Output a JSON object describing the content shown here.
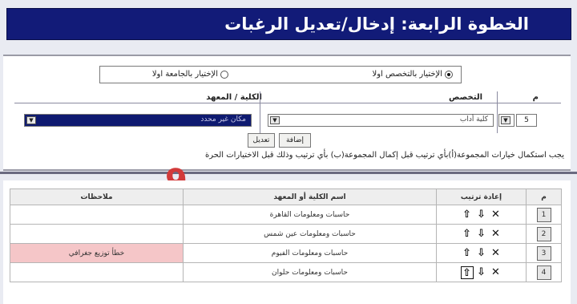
{
  "banner": {
    "title": "الخطوة الرابعة: إدخال/تعديل الرغبات"
  },
  "choice": {
    "option_specialty": "الإختيار بالتخصص اولا",
    "option_university": "الإختيار بالجامعة اولا",
    "selected": "specialty"
  },
  "form": {
    "col_m": "م",
    "col_specialty": "التخصص",
    "col_college": "الكلية / المعهد",
    "row_number": "5",
    "specialty_value": "كلية أداب",
    "college_value": "مكان غير محدد",
    "btn_add": "إضافة",
    "btn_edit": "تعديل",
    "notice": "يجب استكمال خيارات المجموعة(أ)بأي ترتيب قبل إكمال المجموعة(ب) بأي ترتيب وذلك قبل الاختيارات الحرة"
  },
  "annotation": {
    "mark": "9"
  },
  "table": {
    "headers": {
      "m": "م",
      "reorder": "إعادة ترتيب",
      "college": "اسم الكلية أو المعهد",
      "notes": "ملاحظات"
    },
    "rows": [
      {
        "n": "1",
        "college": "حاسبات ومعلومات القاهرة",
        "note": ""
      },
      {
        "n": "2",
        "college": "حاسبات ومعلومات عين شمس",
        "note": ""
      },
      {
        "n": "3",
        "college": "حاسبات ومعلومات الفيوم",
        "note": "خطأ توزيع جغرافي"
      },
      {
        "n": "4",
        "college": "حاسبات ومعلومات حلوان",
        "note": ""
      }
    ],
    "icons": {
      "delete": "✕",
      "down": "⇩",
      "up": "⇧"
    }
  }
}
